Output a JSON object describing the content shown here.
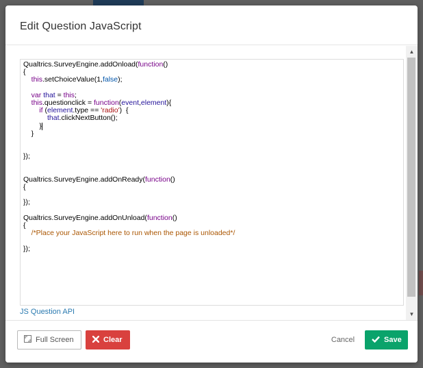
{
  "dialog": {
    "title": "Edit Question JavaScript"
  },
  "editor": {
    "lines": [
      [
        {
          "t": "Qualtrics.SurveyEngine.addOnload(",
          "c": ""
        },
        {
          "t": "function",
          "c": "kw"
        },
        {
          "t": "()",
          "c": ""
        }
      ],
      [
        {
          "t": "{",
          "c": ""
        }
      ],
      [
        {
          "t": "    ",
          "c": ""
        },
        {
          "t": "this",
          "c": "kw"
        },
        {
          "t": ".setChoiceValue(1,",
          "c": ""
        },
        {
          "t": "false",
          "c": "at"
        },
        {
          "t": ");",
          "c": ""
        }
      ],
      [],
      [
        {
          "t": "    ",
          "c": ""
        },
        {
          "t": "var",
          "c": "kw"
        },
        {
          "t": " ",
          "c": ""
        },
        {
          "t": "that",
          "c": "vr"
        },
        {
          "t": " = ",
          "c": ""
        },
        {
          "t": "this",
          "c": "kw"
        },
        {
          "t": ";",
          "c": ""
        }
      ],
      [
        {
          "t": "    ",
          "c": ""
        },
        {
          "t": "this",
          "c": "kw"
        },
        {
          "t": ".questionclick = ",
          "c": ""
        },
        {
          "t": "function",
          "c": "kw"
        },
        {
          "t": "(",
          "c": ""
        },
        {
          "t": "event",
          "c": "vr"
        },
        {
          "t": ",",
          "c": ""
        },
        {
          "t": "element",
          "c": "vr"
        },
        {
          "t": "){",
          "c": ""
        }
      ],
      [
        {
          "t": "        ",
          "c": ""
        },
        {
          "t": "if",
          "c": "kw"
        },
        {
          "t": " (",
          "c": ""
        },
        {
          "t": "element",
          "c": "vr"
        },
        {
          "t": ".type == ",
          "c": ""
        },
        {
          "t": "'radio'",
          "c": "st"
        },
        {
          "t": ")  {",
          "c": ""
        }
      ],
      [
        {
          "t": "            ",
          "c": ""
        },
        {
          "t": "that",
          "c": "vr"
        },
        {
          "t": ".clickNextButton();",
          "c": ""
        }
      ],
      [
        {
          "t": "        }",
          "c": ""
        },
        {
          "cursor": true
        }
      ],
      [
        {
          "t": "    }",
          "c": ""
        }
      ],
      [],
      [],
      [
        {
          "t": "});",
          "c": ""
        }
      ],
      [],
      [],
      [
        {
          "t": "Qualtrics.SurveyEngine.addOnReady(",
          "c": ""
        },
        {
          "t": "function",
          "c": "kw"
        },
        {
          "t": "()",
          "c": ""
        }
      ],
      [
        {
          "t": "{",
          "c": ""
        }
      ],
      [],
      [
        {
          "t": "});",
          "c": ""
        }
      ],
      [],
      [
        {
          "t": "Qualtrics.SurveyEngine.addOnUnload(",
          "c": ""
        },
        {
          "t": "function",
          "c": "kw"
        },
        {
          "t": "()",
          "c": ""
        }
      ],
      [
        {
          "t": "{",
          "c": ""
        }
      ],
      [
        {
          "t": "    ",
          "c": ""
        },
        {
          "t": "/*Place your JavaScript here to run when the page is unloaded*/",
          "c": "cm"
        }
      ],
      [],
      [
        {
          "t": "});",
          "c": ""
        }
      ]
    ]
  },
  "links": {
    "api": "JS Question API"
  },
  "footer": {
    "fullscreen_label": "Full Screen",
    "clear_label": "Clear",
    "cancel_label": "Cancel",
    "save_label": "Save"
  },
  "icons": {
    "fullscreen": "expand-icon",
    "clear": "x-icon",
    "save": "check-icon",
    "scroll_up": "chevron-up-icon",
    "scroll_down": "chevron-down-icon"
  },
  "colors": {
    "clear_button": "#d9413e",
    "save_button": "#0aa36b",
    "link": "#2a7ab0"
  }
}
